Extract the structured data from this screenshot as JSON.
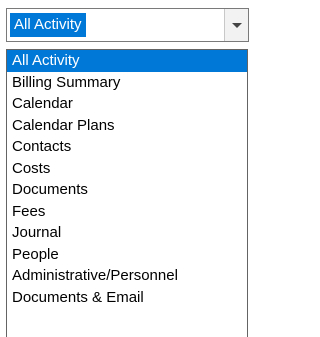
{
  "dropdown": {
    "selected_value": "All Activity",
    "button_icon": "chevron-down-icon",
    "options": [
      {
        "label": "All Activity",
        "selected": true
      },
      {
        "label": "Billing Summary",
        "selected": false
      },
      {
        "label": "Calendar",
        "selected": false
      },
      {
        "label": "Calendar Plans",
        "selected": false
      },
      {
        "label": "Contacts",
        "selected": false
      },
      {
        "label": "Costs",
        "selected": false
      },
      {
        "label": "Documents",
        "selected": false
      },
      {
        "label": "Fees",
        "selected": false
      },
      {
        "label": "Journal",
        "selected": false
      },
      {
        "label": "People",
        "selected": false
      },
      {
        "label": "Administrative/Personnel",
        "selected": false
      },
      {
        "label": "Documents & Email",
        "selected": false
      }
    ]
  },
  "colors": {
    "highlight": "#0078d7",
    "highlight_text": "#ffffff",
    "text": "#000000"
  }
}
